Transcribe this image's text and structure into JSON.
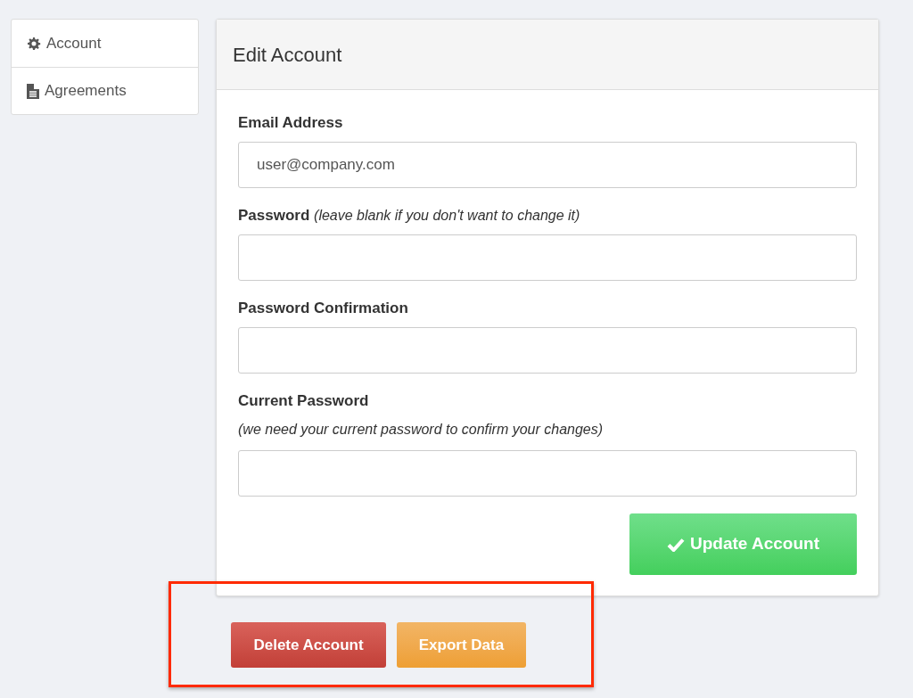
{
  "sidebar": {
    "items": [
      {
        "label": "Account",
        "kind": "gear"
      },
      {
        "label": "Agreements",
        "kind": "document"
      }
    ]
  },
  "panel": {
    "title": "Edit Account",
    "fields": [
      {
        "label": "Email Address",
        "value": "user@company.com"
      },
      {
        "label": "Password",
        "note": "(leave blank if you don't want to change it)",
        "kind": "inline"
      },
      {
        "label": "Password Confirmation"
      },
      {
        "label": "Current Password",
        "note": "(we need your current password to confirm your changes)",
        "kind": "stacked"
      }
    ],
    "submit": {
      "label": "Update Account"
    }
  },
  "actions": [
    {
      "label": "Delete Account",
      "kind": "danger"
    },
    {
      "label": "Export Data",
      "kind": "warning"
    }
  ]
}
